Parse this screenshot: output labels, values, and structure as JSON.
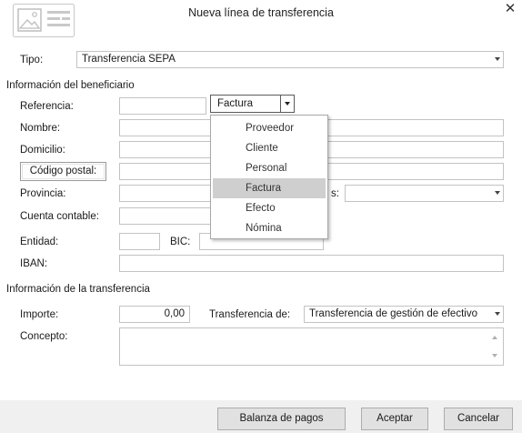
{
  "window": {
    "title": "Nueva línea de transferencia"
  },
  "icons": {
    "logo": "form-icon",
    "close": "close-icon"
  },
  "tipo": {
    "label": "Tipo:",
    "value": "Transferencia SEPA"
  },
  "beneficiario": {
    "section_title": "Información del beneficiario",
    "referencia_label": "Referencia:",
    "referencia_value": "",
    "referencia_type": "Factura",
    "nombre_label": "Nombre:",
    "domicilio_label": "Domicilio:",
    "codigo_postal_button": "Código postal:",
    "provincia_label": "Provincia:",
    "pais_label_fragment": "s:",
    "cuenta_contable_label": "Cuenta contable:",
    "entidad_label": "Entidad:",
    "bic_label": "BIC:",
    "iban_label": "IBAN:"
  },
  "dropdown_menu": {
    "options": [
      "Proveedor",
      "Cliente",
      "Personal",
      "Factura",
      "Efecto",
      "Nómina"
    ],
    "selected": "Factura"
  },
  "transferencia": {
    "section_title": "Información de la transferencia",
    "importe_label": "Importe:",
    "importe_value": "0,00",
    "transferencia_de_label": "Transferencia de:",
    "transferencia_de_value": "Transferencia de gestión de efectivo",
    "concepto_label": "Concepto:"
  },
  "footer": {
    "balanza_button": "Balanza de pagos",
    "aceptar_button": "Aceptar",
    "cancelar_button": "Cancelar"
  },
  "colors": {
    "footer_bg": "#f0f0f0",
    "menu_selected": "#cfcfcf",
    "field_border": "#c3c3c3"
  }
}
